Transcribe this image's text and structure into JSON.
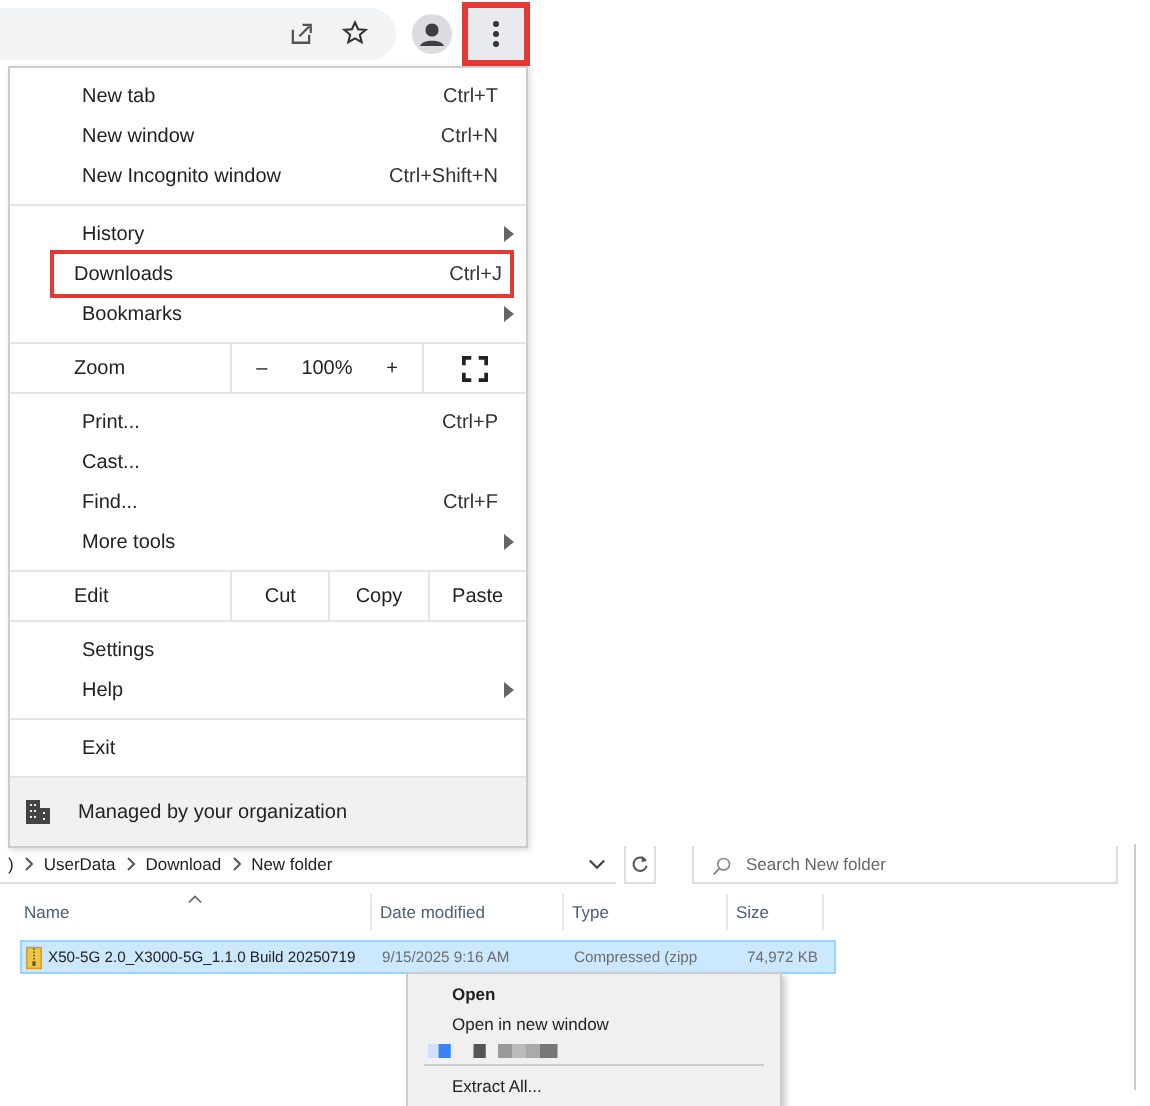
{
  "toolbar": {
    "menu_button": {
      "highlighted": true
    }
  },
  "menu": {
    "sections": [
      {
        "items": [
          {
            "kind": "item",
            "label": "New tab",
            "shortcut": "Ctrl+T"
          },
          {
            "kind": "item",
            "label": "New window",
            "shortcut": "Ctrl+N"
          },
          {
            "kind": "item",
            "label": "New Incognito window",
            "shortcut": "Ctrl+Shift+N"
          }
        ]
      },
      {
        "items": [
          {
            "kind": "item",
            "label": "History",
            "submenu": true
          },
          {
            "kind": "item",
            "label": "Downloads",
            "shortcut": "Ctrl+J",
            "highlighted": true
          },
          {
            "kind": "item",
            "label": "Bookmarks",
            "submenu": true
          }
        ]
      },
      {
        "items": [
          {
            "kind": "zoom",
            "label": "Zoom",
            "minus": "–",
            "value": "100%",
            "plus": "+"
          }
        ]
      },
      {
        "items": [
          {
            "kind": "item",
            "label": "Print...",
            "shortcut": "Ctrl+P"
          },
          {
            "kind": "item",
            "label": "Cast..."
          },
          {
            "kind": "item",
            "label": "Find...",
            "shortcut": "Ctrl+F"
          },
          {
            "kind": "item",
            "label": "More tools",
            "submenu": true
          }
        ]
      },
      {
        "items": [
          {
            "kind": "edit",
            "label": "Edit",
            "actions": [
              "Cut",
              "Copy",
              "Paste"
            ]
          }
        ]
      },
      {
        "items": [
          {
            "kind": "item",
            "label": "Settings"
          },
          {
            "kind": "item",
            "label": "Help",
            "submenu": true
          }
        ]
      },
      {
        "items": [
          {
            "kind": "item",
            "label": "Exit"
          }
        ]
      }
    ],
    "footer": "Managed by your organization"
  },
  "explorer": {
    "breadcrumb": [
      ")",
      "UserData",
      "Download",
      "New folder"
    ],
    "search": {
      "placeholder": "Search New folder"
    },
    "columns": [
      "Name",
      "Date modified",
      "Type",
      "Size"
    ],
    "rows": [
      {
        "name": "X50-5G 2.0_X3000-5G_1.1.0 Build 20250719",
        "date": "9/15/2025 9:16 AM",
        "type": "Compressed (zipp",
        "size": "74,972 KB",
        "selected": true
      }
    ],
    "context_menu": [
      {
        "label": "Open",
        "default": true
      },
      {
        "label": "Open in new window",
        "default": false
      },
      {
        "kind": "separator"
      },
      {
        "label": "Extract All...",
        "default": false
      }
    ]
  }
}
